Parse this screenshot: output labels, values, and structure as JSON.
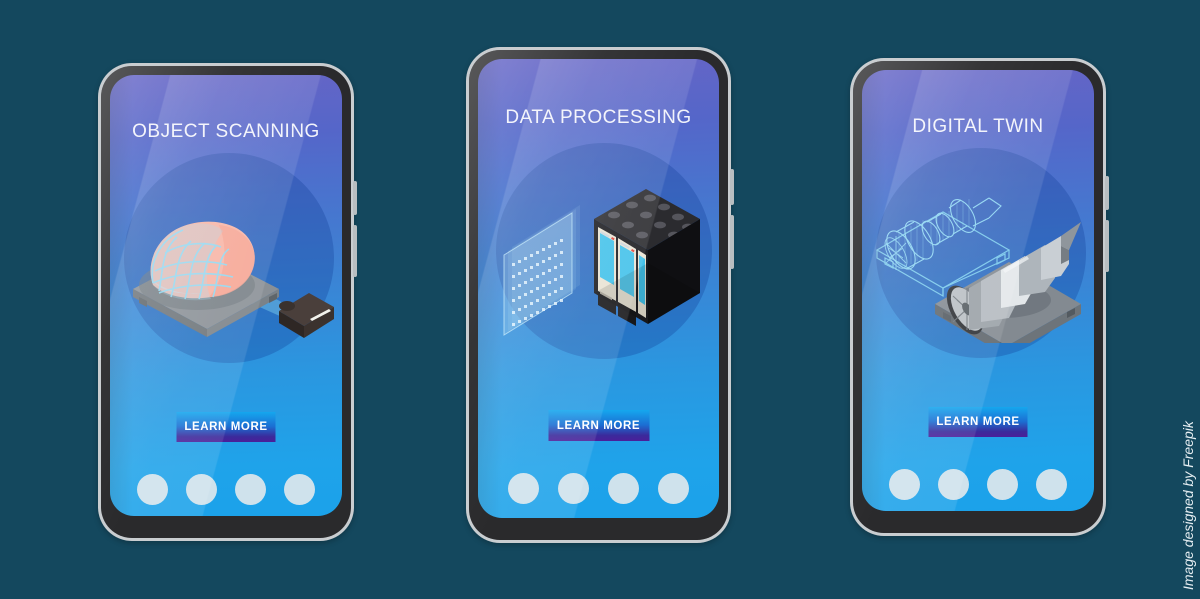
{
  "background_color": "#14485e",
  "watermark": "Image designed by Freepik",
  "theme": {
    "screen_gradient_top": "#6565c6",
    "screen_gradient_bottom": "#1ba2ea",
    "button_gradient_top": "#15a7ee",
    "button_gradient_bottom": "#4b1f9a",
    "dot_color": "#cfe2ec",
    "frame_outer": "#c9cdd0",
    "frame_inner": "#2a2a2c",
    "halo_color": "rgba(18,60,150,0.30)"
  },
  "screens": [
    {
      "id": "object-scanning",
      "title": "OBJECT SCANNING",
      "cta_label": "LEARN MORE",
      "illustration": "brain-3d-scanner",
      "dot_count": 4,
      "active_dot": 1
    },
    {
      "id": "data-processing",
      "title": "DATA PROCESSING",
      "cta_label": "LEARN MORE",
      "illustration": "server-rack-data-plane",
      "dot_count": 4,
      "active_dot": 1
    },
    {
      "id": "digital-twin",
      "title": "DIGITAL TWIN",
      "cta_label": "LEARN MORE",
      "illustration": "jet-turbine-wireframe-twin",
      "dot_count": 4,
      "active_dot": 1
    }
  ]
}
